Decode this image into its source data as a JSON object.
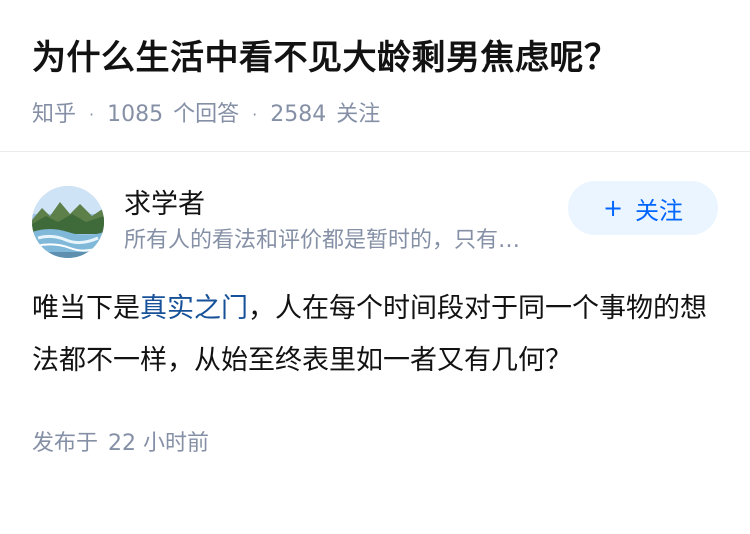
{
  "question": {
    "title": "为什么生活中看不见大龄剩男焦虑呢？",
    "source": "知乎",
    "answer_count": "1085",
    "answer_suffix": "个回答",
    "follow_count": "2584",
    "follow_suffix": "关注"
  },
  "answer": {
    "author": {
      "name": "求学者",
      "bio": "所有人的看法和评价都是暂时的，只有自己的经历伴随一生，…",
      "follow_label": "关注"
    },
    "content": {
      "prefix": "唯当下是",
      "link": "真实之门",
      "rest": "，人在每个时间段对于同一个事物的想法都不一样，从始至终表里如一者又有几何？"
    },
    "footer": {
      "label": "发布于",
      "time": "22 小时前"
    }
  },
  "colors": {
    "accent": "#0066ff",
    "link": "#175199",
    "meta": "#8590a6"
  }
}
